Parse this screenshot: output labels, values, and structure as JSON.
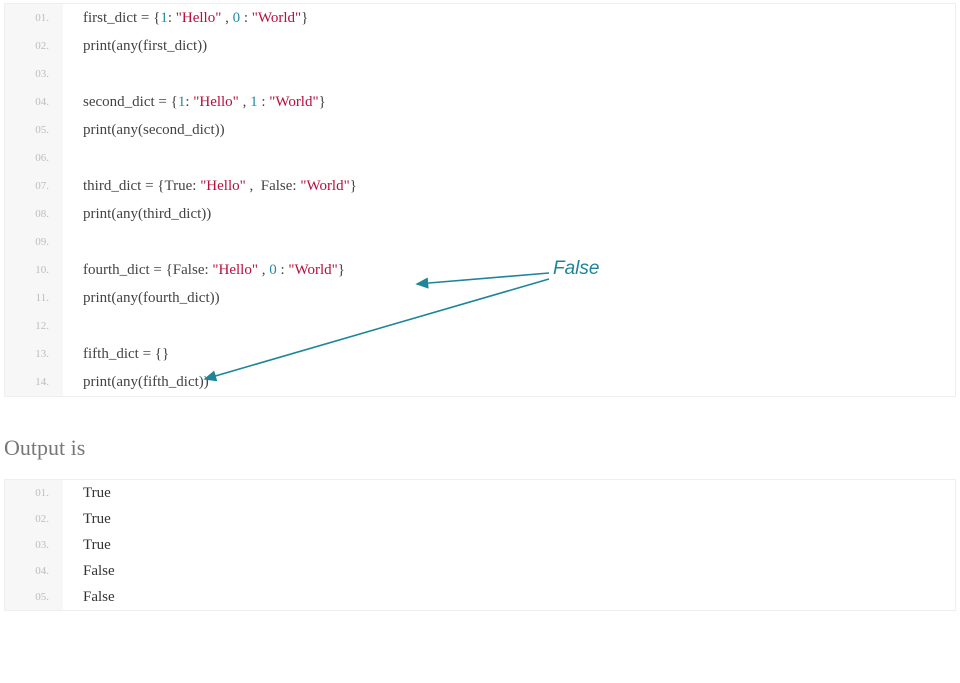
{
  "code": {
    "lines": [
      {
        "n": "01.",
        "tokens": [
          {
            "t": "first_dict = {",
            "c": "tok-def"
          },
          {
            "t": "1",
            "c": "tok-key"
          },
          {
            "t": ": ",
            "c": "tok-def"
          },
          {
            "t": "\"Hello\"",
            "c": "tok-str"
          },
          {
            "t": " , ",
            "c": "tok-def"
          },
          {
            "t": "0",
            "c": "tok-key"
          },
          {
            "t": " : ",
            "c": "tok-def"
          },
          {
            "t": "\"World\"",
            "c": "tok-str"
          },
          {
            "t": "}",
            "c": "tok-def"
          }
        ]
      },
      {
        "n": "02.",
        "tokens": [
          {
            "t": "print(any(first_dict))",
            "c": "tok-def"
          }
        ]
      },
      {
        "n": "03.",
        "tokens": []
      },
      {
        "n": "04.",
        "tokens": [
          {
            "t": "second_dict = {",
            "c": "tok-def"
          },
          {
            "t": "1",
            "c": "tok-key"
          },
          {
            "t": ": ",
            "c": "tok-def"
          },
          {
            "t": "\"Hello\"",
            "c": "tok-str"
          },
          {
            "t": " , ",
            "c": "tok-def"
          },
          {
            "t": "1",
            "c": "tok-key"
          },
          {
            "t": " : ",
            "c": "tok-def"
          },
          {
            "t": "\"World\"",
            "c": "tok-str"
          },
          {
            "t": "}",
            "c": "tok-def"
          }
        ]
      },
      {
        "n": "05.",
        "tokens": [
          {
            "t": "print(any(second_dict))",
            "c": "tok-def"
          }
        ]
      },
      {
        "n": "06.",
        "tokens": []
      },
      {
        "n": "07.",
        "tokens": [
          {
            "t": "third_dict = {True: ",
            "c": "tok-def"
          },
          {
            "t": "\"Hello\"",
            "c": "tok-str"
          },
          {
            "t": " ,  False: ",
            "c": "tok-def"
          },
          {
            "t": "\"World\"",
            "c": "tok-str"
          },
          {
            "t": "}",
            "c": "tok-def"
          }
        ]
      },
      {
        "n": "08.",
        "tokens": [
          {
            "t": "print(any(third_dict))",
            "c": "tok-def"
          }
        ]
      },
      {
        "n": "09.",
        "tokens": []
      },
      {
        "n": "10.",
        "tokens": [
          {
            "t": "fourth_dict = {False: ",
            "c": "tok-def"
          },
          {
            "t": "\"Hello\"",
            "c": "tok-str"
          },
          {
            "t": " , ",
            "c": "tok-def"
          },
          {
            "t": "0",
            "c": "tok-key"
          },
          {
            "t": " : ",
            "c": "tok-def"
          },
          {
            "t": "\"World\"",
            "c": "tok-str"
          },
          {
            "t": "}",
            "c": "tok-def"
          }
        ]
      },
      {
        "n": "11.",
        "tokens": [
          {
            "t": "print(any(fourth_dict))",
            "c": "tok-def"
          }
        ]
      },
      {
        "n": "12.",
        "tokens": []
      },
      {
        "n": "13.",
        "tokens": [
          {
            "t": "fifth_dict = {}",
            "c": "tok-def"
          }
        ]
      },
      {
        "n": "14.",
        "tokens": [
          {
            "t": "print(any(fifth_dict))",
            "c": "tok-def"
          }
        ]
      }
    ]
  },
  "heading": "Output is",
  "output": {
    "lines": [
      {
        "n": "01.",
        "t": "True"
      },
      {
        "n": "02.",
        "t": "True"
      },
      {
        "n": "03.",
        "t": "True"
      },
      {
        "n": "04.",
        "t": "False"
      },
      {
        "n": "05.",
        "t": "False"
      }
    ]
  },
  "annotation": {
    "label": "False",
    "color": "#1e8599"
  }
}
